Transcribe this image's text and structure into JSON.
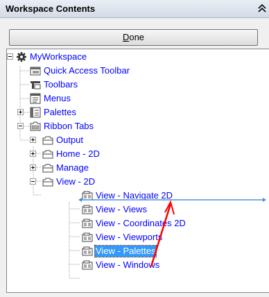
{
  "panel": {
    "title": "Workspace Contents",
    "collapse_icon": "double-chevron-up-icon"
  },
  "done_button": {
    "label_first": "D",
    "label_rest": "one"
  },
  "tree": {
    "root": "MyWorkspace",
    "items": [
      {
        "label": "Quick Access Toolbar",
        "icon": "toolbar-icon"
      },
      {
        "label": "Toolbars",
        "icon": "toolbars-icon"
      },
      {
        "label": "Menus",
        "icon": "menus-icon"
      },
      {
        "label": "Palettes",
        "icon": "palettes-icon"
      },
      {
        "label": "Ribbon Tabs",
        "icon": "ribbon-tabs-icon"
      }
    ],
    "ribbon_tabs": [
      {
        "label": "Output"
      },
      {
        "label": "Home - 2D"
      },
      {
        "label": "Manage"
      },
      {
        "label": "View - 2D"
      }
    ],
    "panels": [
      {
        "label": "View - Navigate 2D"
      },
      {
        "label": "View - Views"
      },
      {
        "label": "View - Coordinates 2D"
      },
      {
        "label": "View - Viewports"
      },
      {
        "label": "View - Palettes",
        "selected": true
      },
      {
        "label": "View - Windows"
      }
    ]
  },
  "colors": {
    "link_text": "#0000ff",
    "selection": "#3399ff",
    "insert_line": "#4a90d9",
    "drag_arrow": "#ff0000"
  }
}
